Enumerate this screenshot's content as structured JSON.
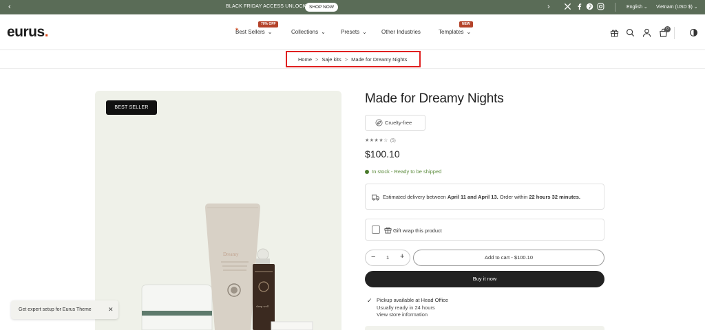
{
  "announcement": {
    "promo_text": "BLACK FRIDAY ACCESS UNLOCKED",
    "shop_button": "SHOP NOW",
    "prev_icon": "chevron-left-icon",
    "next_icon": "chevron-right-icon",
    "social_icons": [
      "x-icon",
      "facebook-icon",
      "pinterest-icon",
      "instagram-icon"
    ],
    "language": "English",
    "region": "Vietnam (USD $)",
    "background_color": "#5a6c57"
  },
  "header": {
    "logo_text": "eurus",
    "logo_dot": ".",
    "logo_accent_color": "#d9481a",
    "nav": [
      {
        "label": "Best Sellers",
        "badge": "70% OFF",
        "has_dropdown": true
      },
      {
        "label": "Collections",
        "has_dropdown": true
      },
      {
        "label": "Presets",
        "has_dropdown": true
      },
      {
        "label": "Other Industries",
        "has_dropdown": false
      },
      {
        "label": "Templates",
        "badge": "NEW",
        "has_dropdown": true
      }
    ],
    "icons": [
      "gift-icon",
      "search-icon",
      "account-icon",
      "cart-icon",
      "theme-toggle-icon"
    ],
    "cart_count": "0"
  },
  "breadcrumb": {
    "items": [
      "Home",
      "Saje kits",
      "Made for Dreamy Nights"
    ],
    "separator": ">"
  },
  "product": {
    "badge": "BEST SELLER",
    "title": "Made for Dreamy Nights",
    "tag": "Cruelty-free",
    "rating_stars": "★★★★☆",
    "rating_count": "(5)",
    "price": "$100.10",
    "stock_text": "In stock - Ready to be shipped",
    "delivery": {
      "prefix": "Estimated delivery between ",
      "dates": "April 11 and April 13.",
      "middle": " Order within ",
      "countdown": "22 hours 32 minutes."
    },
    "gift_wrap_label": "Gift wrap this product",
    "quantity": "1",
    "add_to_cart": "Add to cart - $100.10",
    "buy_now": "Buy it now",
    "pickup": {
      "line1": "Pickup available at Head Office",
      "line2": "Usually ready in 24 hours",
      "line3": "View store information"
    },
    "packaging_text": {
      "tube_label": "Dreamy",
      "roller_label": "sleep well"
    }
  },
  "toast": {
    "message": "Get expert setup for Eurus Theme",
    "close_icon": "close-icon"
  }
}
